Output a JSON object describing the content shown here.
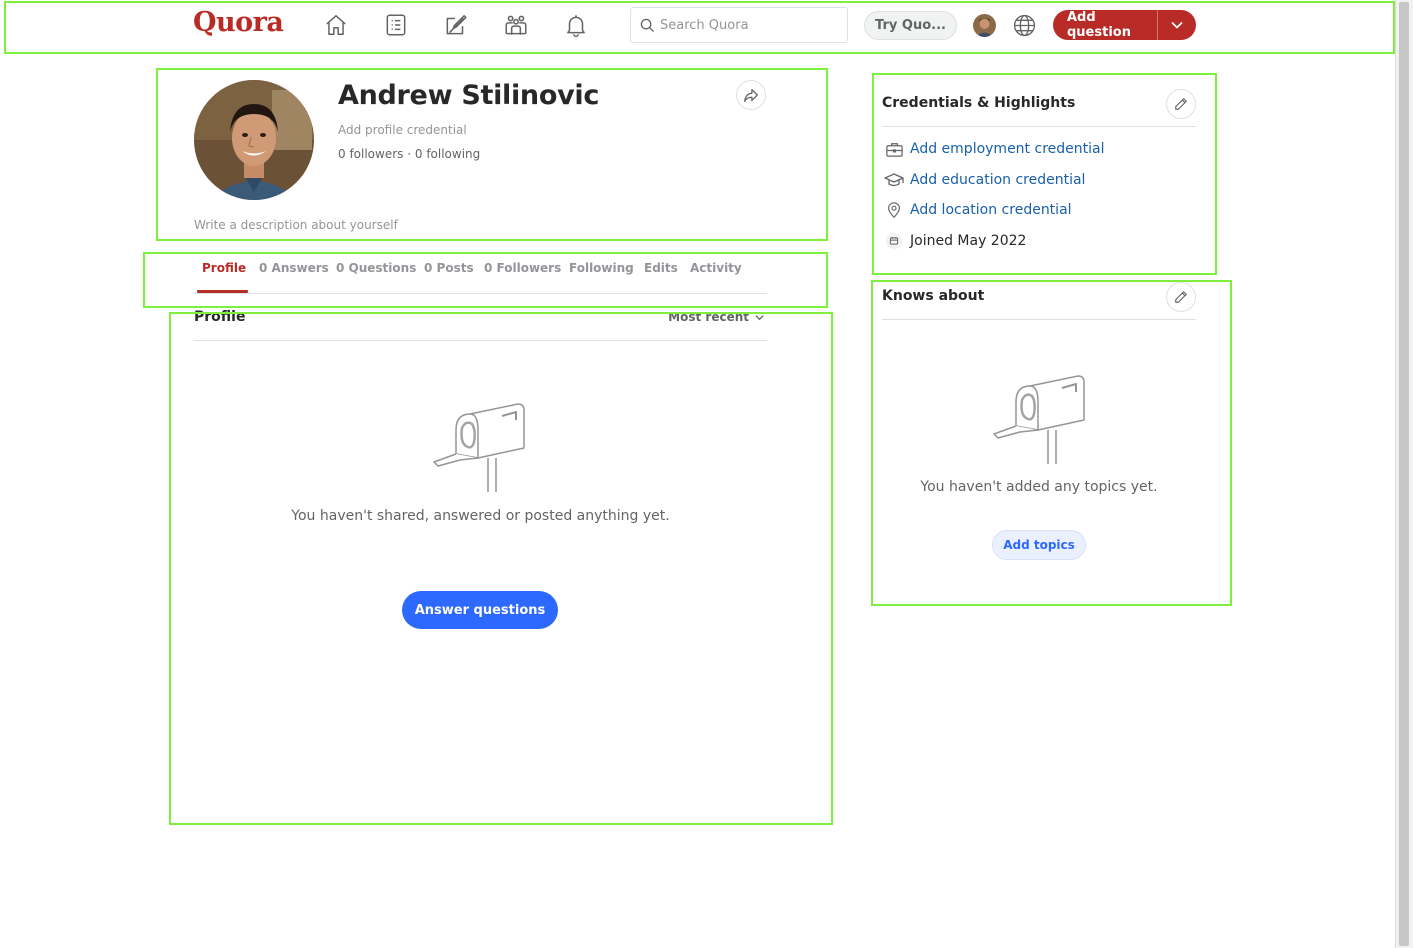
{
  "header": {
    "logo": "Quora",
    "nav": [
      "home-icon",
      "following-icon",
      "answer-icon",
      "spaces-icon",
      "notifications-icon"
    ],
    "search_placeholder": "Search Quora",
    "try_quora": "Try Quo...",
    "add_question": "Add question"
  },
  "profile": {
    "name": "Andrew Stilinovic",
    "credential": "Add profile credential",
    "followers": "0 followers",
    "separator": " · ",
    "following": "0 following",
    "description": "Write a description about yourself"
  },
  "tabs": [
    {
      "label": "Profile",
      "active": true
    },
    {
      "label": "0 Answers"
    },
    {
      "label": "0 Questions"
    },
    {
      "label": "0 Posts"
    },
    {
      "label": "0 Followers"
    },
    {
      "label": "Following"
    },
    {
      "label": "Edits"
    },
    {
      "label": "Activity"
    }
  ],
  "feed": {
    "title": "Profile",
    "sort": "Most recent",
    "empty": "You haven't shared, answered or posted anything yet.",
    "button": "Answer questions"
  },
  "credentials": {
    "title": "Credentials & Highlights",
    "employment": "Add employment credential",
    "education": "Add education credential",
    "location": "Add location credential",
    "joined": "Joined May 2022"
  },
  "knows": {
    "title": "Knows about",
    "empty": "You haven't added any topics yet.",
    "button": "Add topics"
  },
  "colors": {
    "brand": "#b92b27",
    "primary": "#2e69ff",
    "link": "#195faa",
    "annotation": "#7cf03a"
  }
}
